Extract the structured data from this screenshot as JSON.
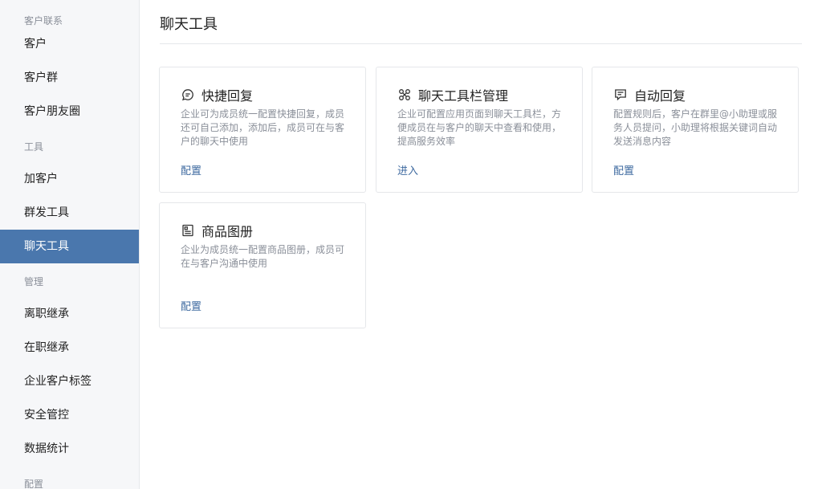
{
  "sidebar": {
    "groups": [
      {
        "label": "客户联系",
        "items": [
          "客户",
          "客户群",
          "客户朋友圈"
        ]
      },
      {
        "label": "工具",
        "items": [
          "加客户",
          "群发工具",
          "聊天工具"
        ]
      },
      {
        "label": "管理",
        "items": [
          "离职继承",
          "在职继承",
          "企业客户标签",
          "安全管控",
          "数据统计"
        ]
      },
      {
        "label": "配置",
        "items": []
      }
    ],
    "active_item": "聊天工具"
  },
  "main": {
    "title": "聊天工具",
    "cards": [
      {
        "icon": "chat-bubble-icon",
        "title": "快捷回复",
        "desc": "企业可为成员统一配置快捷回复，成员还可自己添加，添加后，成员可在与客户的聊天中使用",
        "action": "配置"
      },
      {
        "icon": "grid-tools-icon",
        "title": "聊天工具栏管理",
        "desc": "企业可配置应用页面到聊天工具栏，方便成员在与客户的聊天中查看和使用，提高服务效率",
        "action": "进入"
      },
      {
        "icon": "auto-reply-icon",
        "title": "自动回复",
        "desc": "配置规则后，客户在群里@小助理或服务人员提问，小助理将根据关键词自动发送消息内容",
        "action": "配置"
      },
      {
        "icon": "product-catalog-icon",
        "title": "商品图册",
        "desc": "企业为成员统一配置商品图册，成员可在与客户沟通中使用",
        "action": "配置"
      }
    ]
  },
  "colors": {
    "accent": "#4a77ad",
    "link": "#3e6aa0",
    "muted": "#8a8f99"
  }
}
